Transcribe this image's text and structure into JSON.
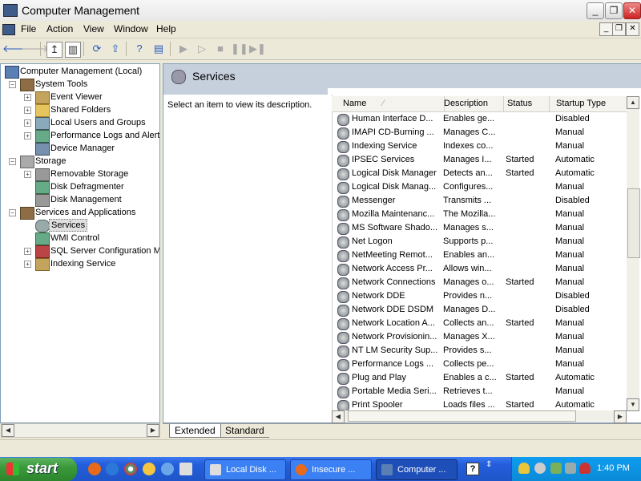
{
  "window": {
    "title": "Computer Management"
  },
  "menu": [
    "File",
    "Action",
    "View",
    "Window",
    "Help"
  ],
  "tree": [
    {
      "label": "Computer Management (Local)",
      "level": 0,
      "expander": "",
      "icon": "computer-icon"
    },
    {
      "label": "System Tools",
      "level": 1,
      "expander": "−",
      "icon": "tools-icon"
    },
    {
      "label": "Event Viewer",
      "level": 2,
      "expander": "+",
      "icon": "event-viewer-icon"
    },
    {
      "label": "Shared Folders",
      "level": 2,
      "expander": "+",
      "icon": "folder-icon"
    },
    {
      "label": "Local Users and Groups",
      "level": 2,
      "expander": "+",
      "icon": "users-icon"
    },
    {
      "label": "Performance Logs and Alerts",
      "level": 2,
      "expander": "+",
      "icon": "chart-icon"
    },
    {
      "label": "Device Manager",
      "level": 2,
      "expander": "",
      "icon": "device-icon"
    },
    {
      "label": "Storage",
      "level": 1,
      "expander": "−",
      "icon": "storage-icon"
    },
    {
      "label": "Removable Storage",
      "level": 2,
      "expander": "+",
      "icon": "removable-storage-icon"
    },
    {
      "label": "Disk Defragmenter",
      "level": 2,
      "expander": "",
      "icon": "defrag-icon"
    },
    {
      "label": "Disk Management",
      "level": 2,
      "expander": "",
      "icon": "disk-icon"
    },
    {
      "label": "Services and Applications",
      "level": 1,
      "expander": "−",
      "icon": "services-apps-icon"
    },
    {
      "label": "Services",
      "level": 2,
      "expander": "",
      "icon": "services-icon",
      "selected": true
    },
    {
      "label": "WMI Control",
      "level": 2,
      "expander": "",
      "icon": "wmi-icon"
    },
    {
      "label": "SQL Server Configuration Ma",
      "level": 2,
      "expander": "+",
      "icon": "sql-icon"
    },
    {
      "label": "Indexing Service",
      "level": 2,
      "expander": "+",
      "icon": "indexing-icon"
    }
  ],
  "panel": {
    "title": "Services",
    "description_hint": "Select an item to view its description."
  },
  "columns": [
    "Name",
    "Description",
    "Status",
    "Startup Type"
  ],
  "services": [
    [
      "Human Interface D...",
      "Enables ge...",
      "",
      "Disabled"
    ],
    [
      "IMAPI CD-Burning ...",
      "Manages C...",
      "",
      "Manual"
    ],
    [
      "Indexing Service",
      "Indexes co...",
      "",
      "Manual"
    ],
    [
      "IPSEC Services",
      "Manages I...",
      "Started",
      "Automatic"
    ],
    [
      "Logical Disk Manager",
      "Detects an...",
      "Started",
      "Automatic"
    ],
    [
      "Logical Disk Manag...",
      "Configures...",
      "",
      "Manual"
    ],
    [
      "Messenger",
      "Transmits ...",
      "",
      "Disabled"
    ],
    [
      "Mozilla Maintenanc...",
      "The Mozilla...",
      "",
      "Manual"
    ],
    [
      "MS Software Shado...",
      "Manages s...",
      "",
      "Manual"
    ],
    [
      "Net Logon",
      "Supports p...",
      "",
      "Manual"
    ],
    [
      "NetMeeting Remot...",
      "Enables an...",
      "",
      "Manual"
    ],
    [
      "Network Access Pr...",
      "Allows win...",
      "",
      "Manual"
    ],
    [
      "Network Connections",
      "Manages o...",
      "Started",
      "Manual"
    ],
    [
      "Network DDE",
      "Provides n...",
      "",
      "Disabled"
    ],
    [
      "Network DDE DSDM",
      "Manages D...",
      "",
      "Disabled"
    ],
    [
      "Network Location A...",
      "Collects an...",
      "Started",
      "Manual"
    ],
    [
      "Network Provisionin...",
      "Manages X...",
      "",
      "Manual"
    ],
    [
      "NT LM Security Sup...",
      "Provides s...",
      "",
      "Manual"
    ],
    [
      "Performance Logs ...",
      "Collects pe...",
      "",
      "Manual"
    ],
    [
      "Plug and Play",
      "Enables a c...",
      "Started",
      "Automatic"
    ],
    [
      "Portable Media Seri...",
      "Retrieves t...",
      "",
      "Manual"
    ],
    [
      "Print Spooler",
      "Loads files ...",
      "Started",
      "Automatic"
    ]
  ],
  "tabs": [
    "Extended",
    "Standard"
  ],
  "taskbar": {
    "start_label": "start",
    "tasks": [
      "Local Disk ...",
      "Insecure ...",
      "Computer ..."
    ],
    "clock": "1:40 PM"
  }
}
